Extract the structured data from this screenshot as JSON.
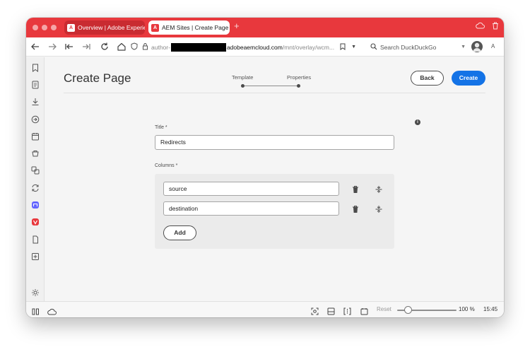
{
  "browser": {
    "tabs": [
      {
        "title": "Overview | Adobe Experie",
        "active": false
      },
      {
        "title": "AEM Sites | Create Page",
        "active": true
      }
    ],
    "address": {
      "prefix": "author-",
      "host": "adobeaemcloud.com",
      "path": "/mnt/overlay/wcm..."
    },
    "search_placeholder": "Search DuckDuckGo",
    "reader_label": "A"
  },
  "page": {
    "title": "Create Page",
    "wizard_steps": [
      "Template",
      "Properties"
    ],
    "back_label": "Back",
    "create_label": "Create"
  },
  "form": {
    "title_label": "Title *",
    "title_value": "Redirects",
    "columns_label": "Columns *",
    "columns": [
      {
        "value": "source"
      },
      {
        "value": "destination"
      }
    ],
    "add_label": "Add"
  },
  "statusbar": {
    "reset_label": "Reset",
    "zoom": "100 %",
    "time": "15:45"
  },
  "colors": {
    "tabbar": "#e8383d",
    "primary_button": "#1473e6"
  }
}
